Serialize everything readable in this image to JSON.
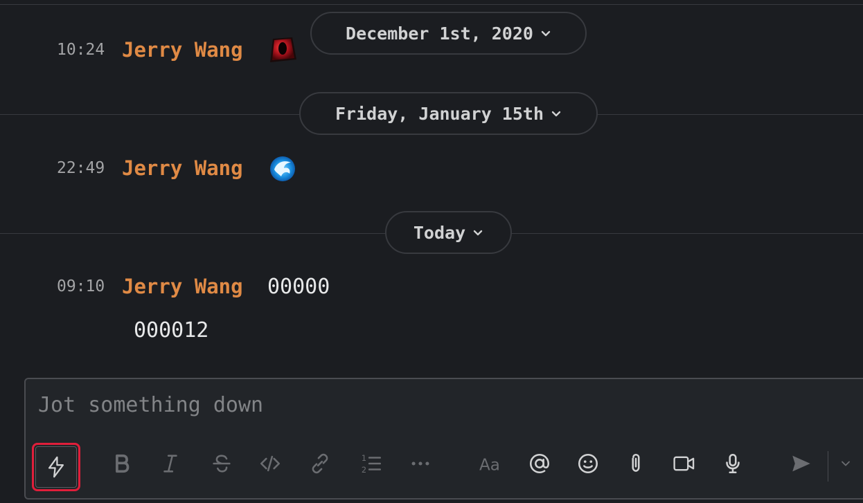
{
  "timeline": {
    "dividers": [
      {
        "label": "December 1st, 2020"
      },
      {
        "label": "Friday, January 15th"
      },
      {
        "label": "Today"
      }
    ],
    "messages": [
      {
        "time": "10:24",
        "author": "Jerry Wang",
        "content_icon": "red-gem-emoji"
      },
      {
        "time": "22:49",
        "author": "Jerry Wang",
        "content_icon": "blue-phoenix-emoji"
      },
      {
        "time": "09:10",
        "author": "Jerry Wang",
        "text": "00000",
        "continuation": "000012"
      }
    ]
  },
  "composer": {
    "placeholder": "Jot something down",
    "toolbar": [
      {
        "name": "shortcuts",
        "icon": "lightning-icon",
        "focused": true
      },
      {
        "name": "bold",
        "icon": "bold-icon",
        "enabled": false
      },
      {
        "name": "italic",
        "icon": "italic-icon",
        "enabled": false
      },
      {
        "name": "strikethrough",
        "icon": "strikethrough-icon",
        "enabled": false
      },
      {
        "name": "code",
        "icon": "code-icon",
        "enabled": false
      },
      {
        "name": "link",
        "icon": "link-icon",
        "enabled": false
      },
      {
        "name": "ordered-list",
        "icon": "ordered-list-icon",
        "enabled": false
      },
      {
        "name": "more-formatting",
        "icon": "ellipsis-icon",
        "enabled": false
      },
      {
        "name": "formatting-toggle",
        "icon": "text-format-icon",
        "enabled": false
      },
      {
        "name": "mention",
        "icon": "at-icon"
      },
      {
        "name": "emoji",
        "icon": "smiley-icon"
      },
      {
        "name": "attach",
        "icon": "paperclip-icon"
      },
      {
        "name": "video",
        "icon": "video-camera-icon"
      },
      {
        "name": "audio",
        "icon": "microphone-icon"
      },
      {
        "name": "send",
        "icon": "send-icon",
        "enabled": false
      },
      {
        "name": "send-options",
        "icon": "chevron-down-icon",
        "enabled": false
      }
    ]
  },
  "colors": {
    "background": "#1b1d21",
    "author": "#e08a45",
    "divider": "#383a3f",
    "focus_ring": "#e01e3a"
  }
}
